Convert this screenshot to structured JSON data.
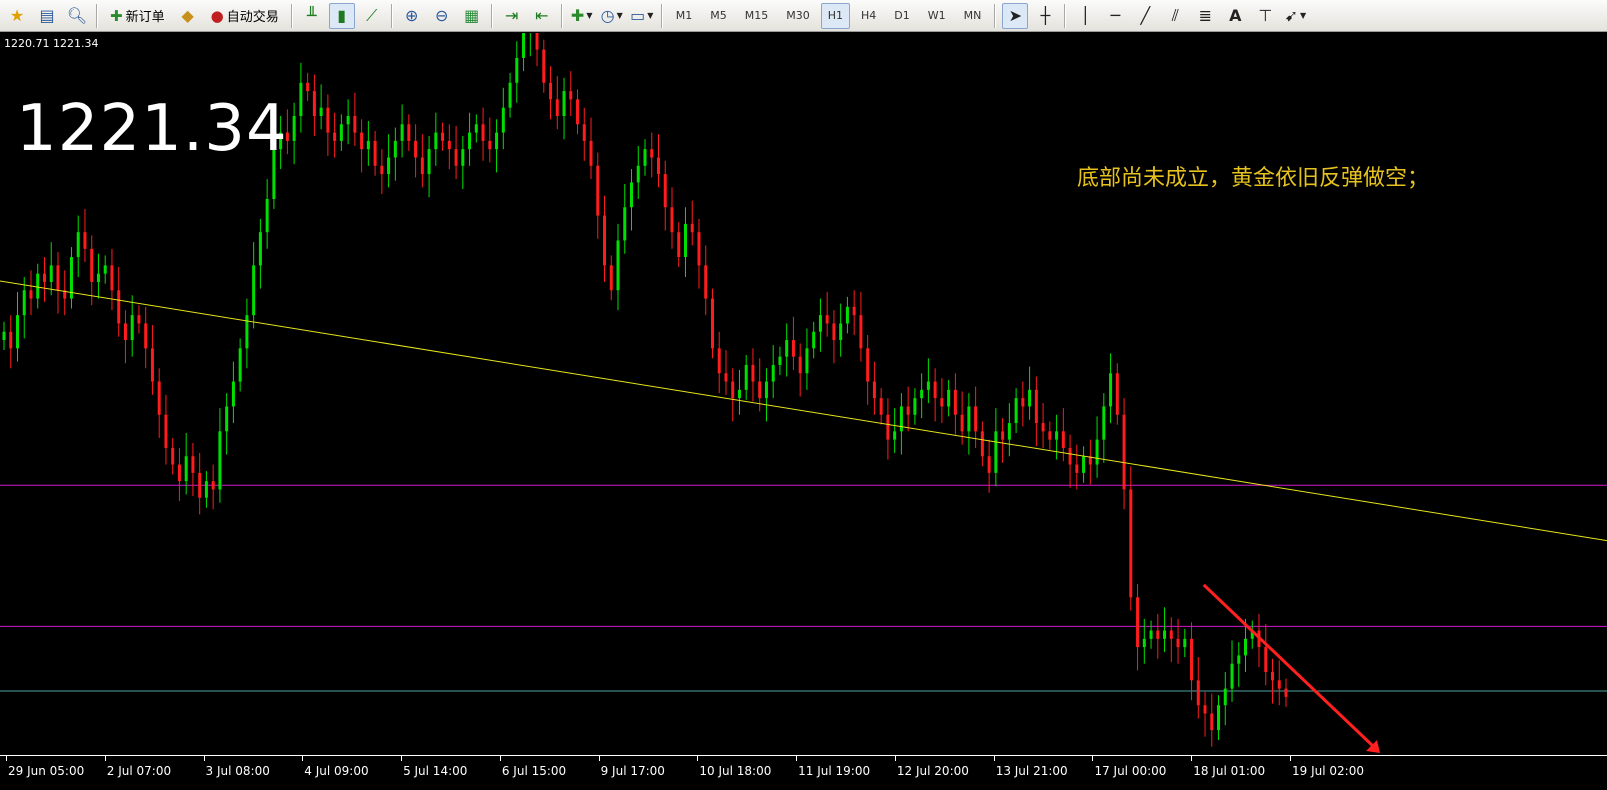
{
  "toolbar": {
    "new_order_label": "新订单",
    "auto_trading_label": "自动交易",
    "timeframes": [
      "M1",
      "M5",
      "M15",
      "M30",
      "H1",
      "H4",
      "D1",
      "W1",
      "MN"
    ],
    "active_timeframe": "H1",
    "text_tool_label": "A"
  },
  "chart": {
    "info_line": "1220.71 1221.34",
    "big_price": "1221.34",
    "annotation": "底部尚未成立，黄金依旧反弹做空；",
    "time_labels": [
      "29 Jun 05:00",
      "2 Jul 07:00",
      "3 Jul 08:00",
      "4 Jul 09:00",
      "5 Jul 14:00",
      "6 Jul 15:00",
      "9 Jul 17:00",
      "10 Jul 18:00",
      "11 Jul 19:00",
      "12 Jul 20:00",
      "13 Jul 21:00",
      "17 Jul 00:00",
      "18 Jul 01:00",
      "19 Jul 02:00"
    ]
  },
  "colors": {
    "background": "#000000",
    "bull": "#00e000",
    "bear": "#ff1c1c",
    "trendline": "#e6e619",
    "horizontal_level": "#d018d0",
    "support_level": "#4fa3a3",
    "arrow": "#ff2020",
    "annotation": "#e6c21e"
  },
  "chart_data": {
    "type": "candlestick",
    "series": [
      {
        "name": "",
        "values": [
          1264,
          1262,
          1266,
          1269,
          1268,
          1271,
          1270,
          1272,
          1269,
          1268,
          1273,
          1276,
          1274,
          1270,
          1271,
          1272,
          1269,
          1265,
          1263,
          1266,
          1265,
          1262,
          1258,
          1254,
          1250,
          1248,
          1246,
          1249,
          1247,
          1244,
          1246,
          1245,
          1252,
          1255,
          1258,
          1262,
          1266,
          1272,
          1276,
          1280,
          1286,
          1288,
          1287,
          1290,
          1294,
          1293,
          1290,
          1291,
          1288,
          1287,
          1289,
          1290,
          1288,
          1286,
          1287,
          1284,
          1283,
          1285,
          1287,
          1289,
          1287,
          1285,
          1283,
          1286,
          1288,
          1287,
          1286,
          1284,
          1286,
          1288,
          1289,
          1287,
          1286,
          1288,
          1291,
          1294,
          1297,
          1300,
          1303,
          1298,
          1294,
          1292,
          1290,
          1293,
          1292,
          1289,
          1287,
          1284,
          1278,
          1272,
          1269,
          1275,
          1279,
          1282,
          1284,
          1286,
          1285,
          1283,
          1279,
          1276,
          1273,
          1277,
          1276,
          1272,
          1268,
          1262,
          1259,
          1258,
          1256,
          1257,
          1260,
          1258,
          1256,
          1258,
          1260,
          1261,
          1263,
          1261,
          1259,
          1262,
          1264,
          1266,
          1265,
          1263,
          1265,
          1267,
          1266,
          1262,
          1258,
          1256,
          1254,
          1251,
          1252,
          1255,
          1254,
          1256,
          1257,
          1258,
          1256,
          1255,
          1257,
          1254,
          1252,
          1255,
          1252,
          1249,
          1247,
          1252,
          1251,
          1253,
          1256,
          1255,
          1257,
          1253,
          1252,
          1251,
          1252,
          1250,
          1248,
          1247,
          1249,
          1248,
          1251,
          1255,
          1259,
          1254,
          1245,
          1232,
          1226,
          1227,
          1228,
          1227,
          1228,
          1227,
          1226,
          1227,
          1222,
          1219,
          1218,
          1216,
          1219,
          1221,
          1224,
          1225,
          1227,
          1228,
          1226,
          1223,
          1222,
          1221,
          1220
        ]
      }
    ],
    "trendline": {
      "from": {
        "x": "29 Jun 05:00",
        "y": 1270
      },
      "to": {
        "x": "19 Jul 02:00",
        "y": 1245
      }
    },
    "horizontal_levels": [
      1245.5,
      1228.5,
      1220.71
    ],
    "last_price": 1221.34,
    "xlabel": "",
    "ylabel": "",
    "ylim": [
      1213,
      1300
    ],
    "x_ticks": [
      "29 Jun 05:00",
      "2 Jul 07:00",
      "3 Jul 08:00",
      "4 Jul 09:00",
      "5 Jul 14:00",
      "6 Jul 15:00",
      "9 Jul 17:00",
      "10 Jul 18:00",
      "11 Jul 19:00",
      "12 Jul 20:00",
      "13 Jul 21:00",
      "17 Jul 00:00",
      "18 Jul 01:00",
      "19 Jul 02:00"
    ]
  }
}
